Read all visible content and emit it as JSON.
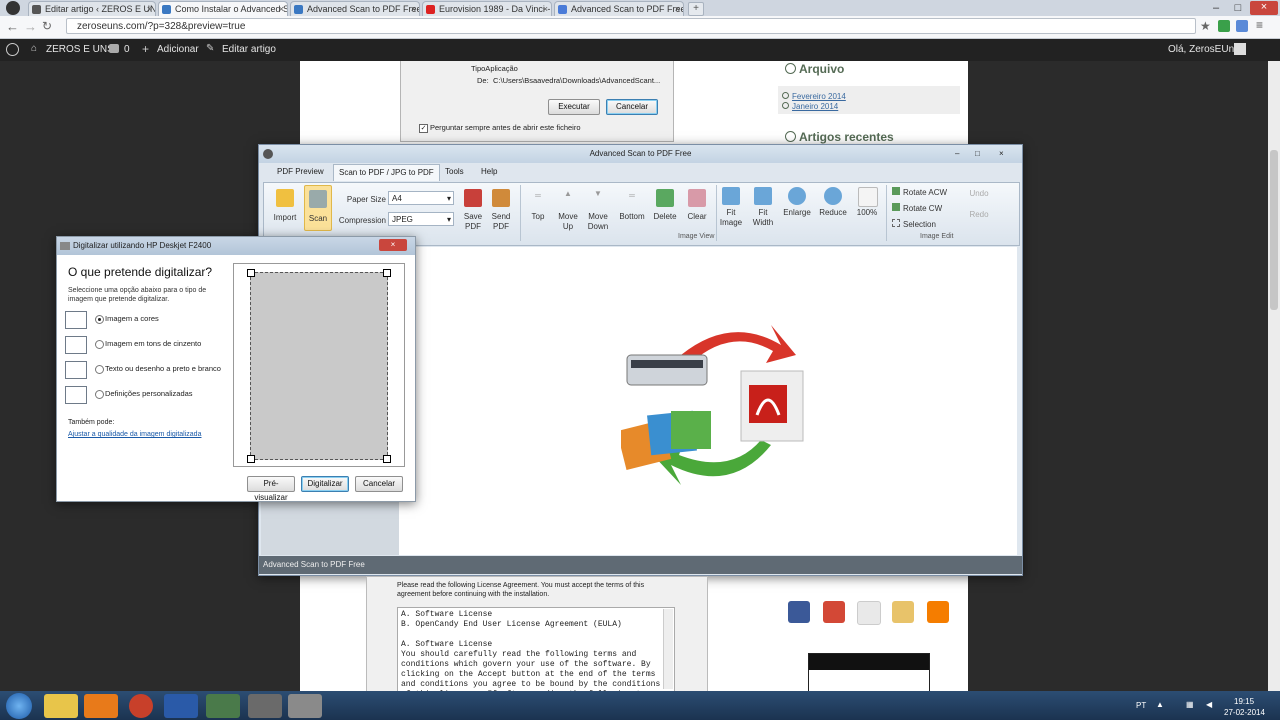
{
  "browser": {
    "tabs": [
      {
        "label": "Editar artigo ‹ ZEROS E UNS"
      },
      {
        "label": "Como Instalar o Advanced S"
      },
      {
        "label": "Advanced Scan to PDF Free"
      },
      {
        "label": "Eurovision 1989 - Da Vinci -"
      },
      {
        "label": "Advanced Scan to PDF Free"
      }
    ],
    "url": "zeroseuns.com/?p=328&preview=true"
  },
  "wp_bar": {
    "site": "ZEROS E UNS",
    "comments": "0",
    "add": "Adicionar",
    "edit": "Editar artigo",
    "greeting": "Olá, ZerosEUns!"
  },
  "sidebar": {
    "archive_title": "Arquivo",
    "archive_items": [
      "Fevereiro 2014",
      "Janeiro 2014"
    ],
    "recent_title": "Artigos recentes"
  },
  "top_dialog": {
    "type_label": "TipoAplicação",
    "from_label": "De:",
    "path": "C:\\Users\\Bsaavedra\\Downloads\\AdvancedScant...",
    "run": "Executar",
    "cancel": "Cancelar",
    "checkbox": "Perguntar sempre antes de abrir este ficheiro"
  },
  "app": {
    "title": "Advanced Scan to PDF Free",
    "tabs": [
      "PDF Preview",
      "Scan to PDF / JPG to PDF",
      "Tools",
      "Help"
    ],
    "ribbon": {
      "import": "Import",
      "scan": "Scan",
      "paper_size_label": "Paper Size",
      "paper_size": "A4",
      "compression_label": "Compression",
      "compression": "JPEG",
      "save_pdf": "Save PDF",
      "send_pdf": "Send PDF",
      "top": "Top",
      "move_up": "Move Up",
      "move_down": "Move Down",
      "bottom": "Bottom",
      "delete": "Delete",
      "clear": "Clear",
      "fit_image": "Fit Image",
      "fit_width": "Fit Width",
      "enlarge": "Enlarge",
      "reduce": "Reduce",
      "zoom": "100%",
      "rotate_acw": "Rotate ACW",
      "rotate_cw": "Rotate CW",
      "selection": "Selection",
      "undo": "Undo",
      "redo": "Redo",
      "group_image_view": "Image View",
      "group_image_edit": "Image Edit"
    },
    "status": "Advanced Scan to PDF Free"
  },
  "scan_dialog": {
    "title": "Digitalizar utilizando HP Deskjet F2400",
    "heading": "O que pretende digitalizar?",
    "instruction": "Seleccione uma opção abaixo para o tipo de imagem que pretende digitalizar.",
    "options": [
      {
        "label": "Imagem a cores"
      },
      {
        "label": "Imagem em tons de cinzento"
      },
      {
        "label": "Texto ou desenho a preto e branco"
      },
      {
        "label": "Definições personalizadas"
      }
    ],
    "also_label": "Também pode:",
    "quality_link": "Ajustar a qualidade da imagem digitalizada",
    "preview": "Pré-visualizar",
    "scan": "Digitalizar",
    "cancel": "Cancelar"
  },
  "license": {
    "intro": "Please read the following License Agreement. You must accept the terms of this agreement before continuing with the installation.",
    "text": "A. Software License\nB. OpenCandy End User License Agreement (EULA)\n\nA. Software License\nYou should carefully read the following terms and\nconditions which govern your use of the software. By\nclicking on the Accept button at the end of the terms\nand conditions you agree to be bound by the conditions\nof this license.  If after reading the following terms"
  },
  "taskbar": {
    "lang": "PT",
    "time": "19:15",
    "date": "27-02-2014"
  }
}
